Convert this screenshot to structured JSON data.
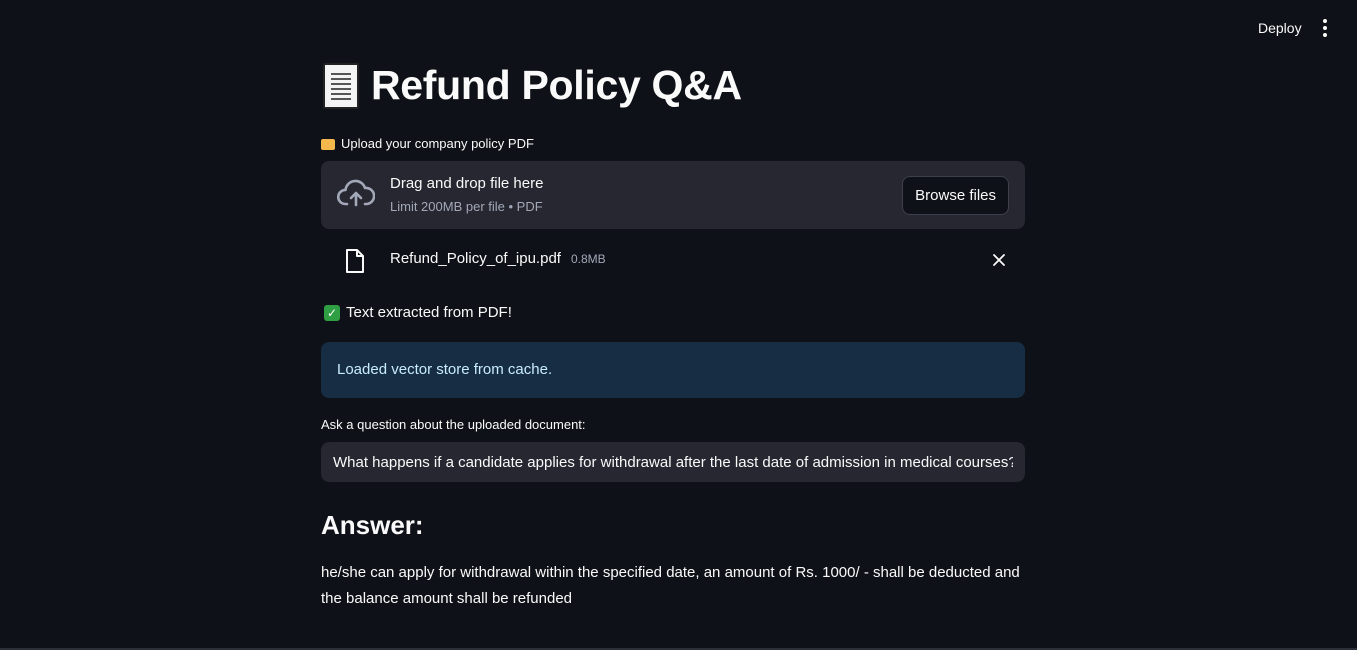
{
  "header": {
    "deploy_label": "Deploy",
    "menu_icon": "kebab-menu-icon"
  },
  "title": {
    "icon": "page-facing-up-icon",
    "text": "Refund Policy Q&A"
  },
  "uploader": {
    "label_icon": "open-folder-icon",
    "label": "Upload your company policy PDF",
    "drop_title": "Drag and drop file here",
    "drop_subtitle": "Limit 200MB per file • PDF",
    "browse_label": "Browse files"
  },
  "file": {
    "name": "Refund_Policy_of_ipu.pdf",
    "size": "0.8MB"
  },
  "success": {
    "icon": "check-mark-icon",
    "text": "Text extracted from PDF!"
  },
  "info": {
    "text": "Loaded vector store from cache."
  },
  "question": {
    "label": "Ask a question about the uploaded document:",
    "value": "What happens if a candidate applies for withdrawal after the last date of admission in medical courses?"
  },
  "answer": {
    "heading": "Answer:",
    "text": "he/she can apply for withdrawal within the specified date, an amount of Rs. 1000/ - shall be deducted and the balance amount shall be refunded"
  },
  "colors": {
    "background": "#0e1117",
    "surface": "#262730",
    "info_background": "#172d43",
    "info_text": "#c7ebff",
    "success_green": "#2ea043"
  }
}
